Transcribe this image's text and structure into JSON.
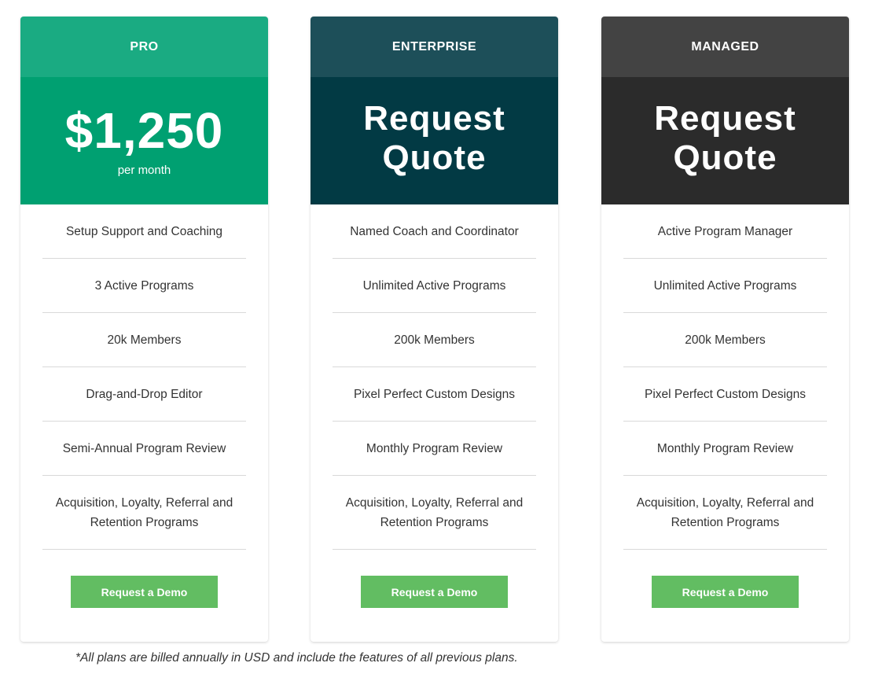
{
  "plans": [
    {
      "name": "PRO",
      "price_main": "$1,250",
      "price_sub": "per month",
      "head_color": "#1aab82",
      "price_color": "#00a071",
      "features": [
        "Setup Support and Coaching",
        "3 Active Programs",
        "20k Members",
        "Drag-and-Drop Editor",
        "Semi-Annual Program Review",
        "Acquisition, Loyalty, Referral and Retention Programs"
      ],
      "button_label": "Request a Demo"
    },
    {
      "name": "ENTERPRISE",
      "price_main": "Request Quote",
      "head_color": "#1d4f59",
      "price_color": "#023a44",
      "features": [
        "Named Coach and Coordinator",
        "Unlimited Active Programs",
        "200k Members",
        "Pixel Perfect Custom Designs",
        "Monthly Program Review",
        "Acquisition, Loyalty, Referral and Retention Programs"
      ],
      "button_label": "Request a Demo"
    },
    {
      "name": "MANAGED",
      "price_main": "Request Quote",
      "head_color": "#434343",
      "price_color": "#2b2b2b",
      "features": [
        "Active Program Manager",
        "Unlimited Active Programs",
        "200k Members",
        "Pixel Perfect Custom Designs",
        "Monthly Program Review",
        "Acquisition, Loyalty, Referral and Retention Programs"
      ],
      "button_label": "Request a Demo"
    }
  ],
  "button_color": "#62bd62",
  "footnote": "*All plans are billed annually in USD and include the features of all previous plans."
}
